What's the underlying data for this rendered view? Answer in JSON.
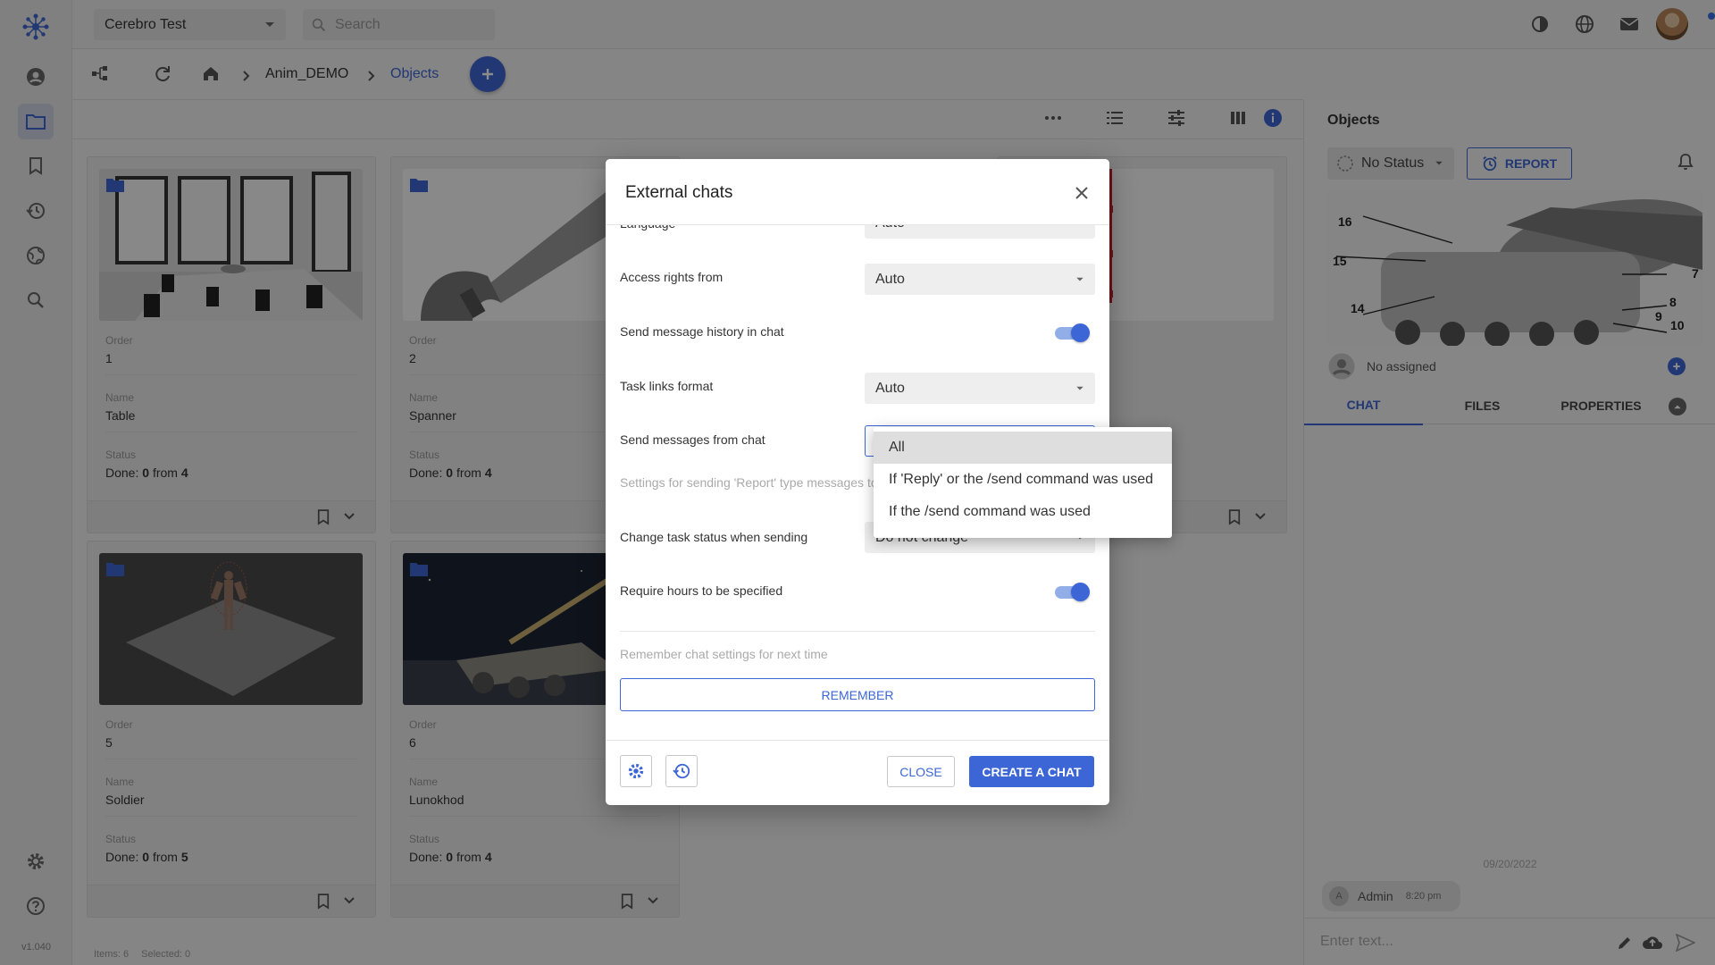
{
  "app": {
    "version": "v1.040"
  },
  "topbar": {
    "project": "Cerebro Test",
    "search_placeholder": "Search"
  },
  "breadcrumb": {
    "items": [
      "Anim_DEMO",
      "Objects"
    ]
  },
  "labels": {
    "order": "Order",
    "name": "Name",
    "status": "Status",
    "done_prefix": "Done:",
    "from": "from"
  },
  "cards": [
    {
      "order": "1",
      "name": "Table",
      "done": "0",
      "total": "4"
    },
    {
      "order": "2",
      "name": "Spanner",
      "done": "0",
      "total": "4"
    },
    {
      "order": "5",
      "name": "Soldier",
      "done": "0",
      "total": "5"
    },
    {
      "order": "6",
      "name": "Lunokhod",
      "done": "0",
      "total": "4"
    }
  ],
  "right_panel": {
    "title": "Objects",
    "status": "No Status",
    "report": "REPORT",
    "assigned": "No assigned",
    "tabs": [
      "CHAT",
      "FILES",
      "PROPERTIES"
    ],
    "active_tab": "CHAT",
    "chat_date": "09/20/2022",
    "chat_user_initial": "A",
    "chat_user": "Admin",
    "chat_time": "8:20 pm",
    "input_placeholder": "Enter text...",
    "diagram_numbers": [
      "16",
      "15",
      "14",
      "7",
      "8",
      "9",
      "10"
    ]
  },
  "statusbar": {
    "items": "Items: 6",
    "selected": "Selected: 0"
  },
  "modal": {
    "title": "External chats",
    "language_label": "Language",
    "language_value": "Auto",
    "access_label": "Access rights from",
    "access_value": "Auto",
    "history_label": "Send message history in chat",
    "history_on": true,
    "task_links_label": "Task links format",
    "task_links_value": "Auto",
    "send_from_chat_label": "Send messages from chat",
    "report_hint": "Settings for sending 'Report' type messages to",
    "change_status_label": "Change task status when sending",
    "change_status_value": "Do not change",
    "require_hours_label": "Require hours to be specified",
    "require_hours_on": true,
    "remember_hint": "Remember chat settings for next time",
    "remember_btn": "REMEMBER",
    "close_btn": "CLOSE",
    "create_btn": "CREATE A CHAT"
  },
  "dropdown": {
    "options": [
      "All",
      "If 'Reply' or the /send command was used",
      "If the /send command was used"
    ],
    "highlighted": "All"
  },
  "colors": {
    "accent": "#3c66d6",
    "overlay": "rgba(0,0,0,0.45)"
  }
}
